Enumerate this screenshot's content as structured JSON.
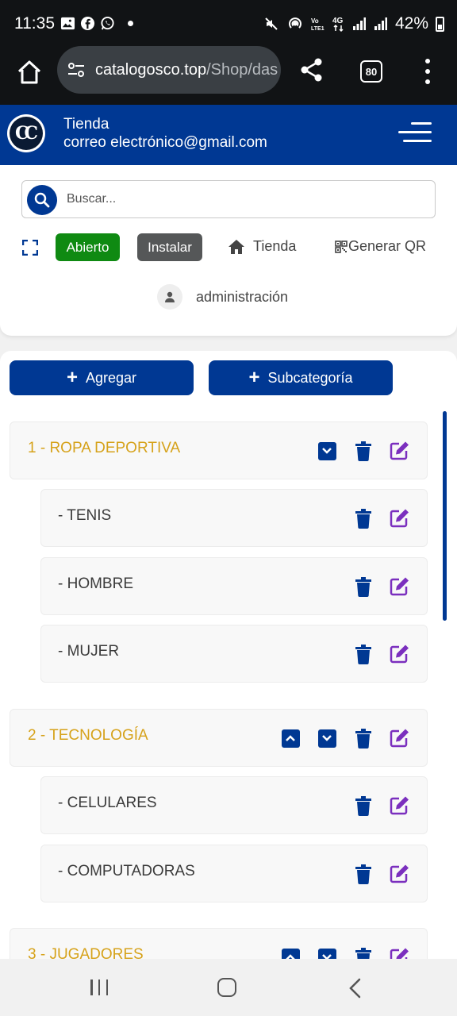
{
  "status_bar": {
    "time": "11:35",
    "battery": "42%",
    "left_icons": [
      "image-icon",
      "facebook-icon",
      "whatsapp-icon",
      "notification-dot"
    ],
    "right_icons": [
      "mute-icon",
      "hotspot-icon",
      "volte-icon",
      "4g-icon",
      "signal-icon",
      "signal-icon",
      "battery-icon"
    ]
  },
  "browser": {
    "url_host": "catalogosco.top",
    "url_path": "/Shop/das",
    "tab_count": "80"
  },
  "header": {
    "logo_text": "CC",
    "store_name": "Tienda",
    "email": "correo electrónico@gmail.com"
  },
  "search": {
    "placeholder": "Buscar..."
  },
  "toolbar": {
    "open_label": "Abierto",
    "install_label": "Instalar",
    "store_label": "Tienda",
    "qr_label": "Generar QR"
  },
  "admin": {
    "label": "administración"
  },
  "actions": {
    "add_label": "Agregar",
    "subcategory_label": "Subcategoría"
  },
  "categories": [
    {
      "title": "1 - ROPA DEPORTIVA",
      "subcategories": [
        "- TENIS",
        "- HOMBRE",
        "- MUJER"
      ]
    },
    {
      "title": "2 - TECNOLOGÍA",
      "subcategories": [
        "- CELULARES",
        "- COMPUTADORAS"
      ]
    },
    {
      "title": "3 - JUGADORES",
      "subcategories": []
    }
  ],
  "colors": {
    "brand_blue": "#003893",
    "category_gold": "#d6a21a",
    "edit_purple": "#7b2fbe",
    "open_green": "#0f8a12",
    "install_gray": "#555758"
  }
}
